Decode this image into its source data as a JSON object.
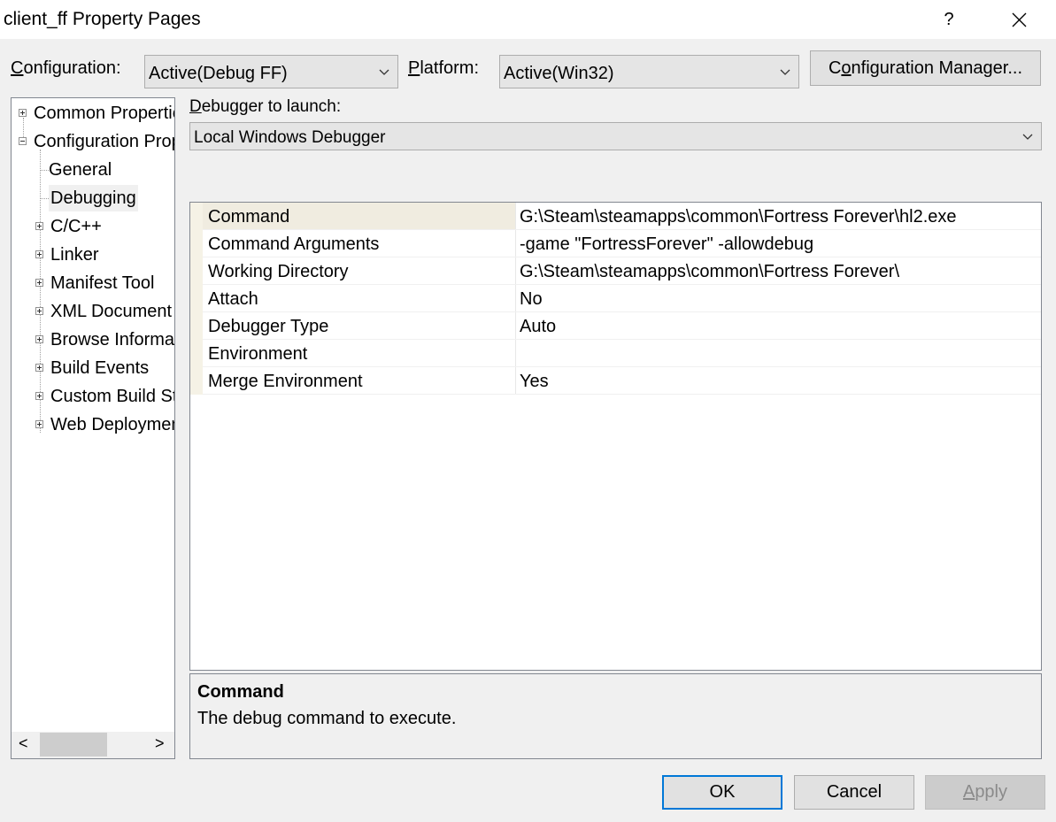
{
  "window": {
    "title": "client_ff Property Pages",
    "help": "?",
    "close": "×"
  },
  "toolbar": {
    "configuration_label_prefix": "",
    "configuration_label_key": "C",
    "configuration_label_rest": "onfiguration:",
    "configuration_value": "Active(Debug FF)",
    "platform_label_key": "P",
    "platform_label_rest": "latform:",
    "platform_value": "Active(Win32)",
    "config_manager_key": "o",
    "config_manager_pre": "C",
    "config_manager_rest": "nfiguration Manager..."
  },
  "tree": {
    "items": [
      {
        "label": "Common Properties",
        "expander": "plus"
      },
      {
        "label": "Configuration Properties",
        "expander": "minus"
      },
      {
        "label": "General",
        "expander": "none"
      },
      {
        "label": "Debugging",
        "expander": "none",
        "selected": true
      },
      {
        "label": "C/C++",
        "expander": "plus"
      },
      {
        "label": "Linker",
        "expander": "plus"
      },
      {
        "label": "Manifest Tool",
        "expander": "plus"
      },
      {
        "label": "XML Document Generator",
        "expander": "plus"
      },
      {
        "label": "Browse Information",
        "expander": "plus"
      },
      {
        "label": "Build Events",
        "expander": "plus"
      },
      {
        "label": "Custom Build Step",
        "expander": "plus"
      },
      {
        "label": "Web Deployment",
        "expander": "plus"
      }
    ],
    "scroll_left": "<",
    "scroll_right": ">"
  },
  "debugger": {
    "label_key": "D",
    "label_rest": "ebugger to launch:",
    "value": "Local Windows Debugger"
  },
  "properties": [
    {
      "name": "Command",
      "value": "G:\\Steam\\steamapps\\common\\Fortress Forever\\hl2.exe",
      "selected": true
    },
    {
      "name": "Command Arguments",
      "value": "-game \"FortressForever\" -allowdebug"
    },
    {
      "name": "Working Directory",
      "value": "G:\\Steam\\steamapps\\common\\Fortress Forever\\"
    },
    {
      "name": "Attach",
      "value": "No"
    },
    {
      "name": "Debugger Type",
      "value": "Auto"
    },
    {
      "name": "Environment",
      "value": ""
    },
    {
      "name": "Merge Environment",
      "value": "Yes"
    }
  ],
  "description": {
    "title": "Command",
    "text": "The debug command to execute."
  },
  "buttons": {
    "ok": "OK",
    "cancel": "Cancel",
    "apply_key": "A",
    "apply_rest": "pply"
  },
  "colors": {
    "selected_row": "#f0ece0",
    "tree_selected": "#f0f0f0",
    "ok_border": "#0078d7"
  }
}
